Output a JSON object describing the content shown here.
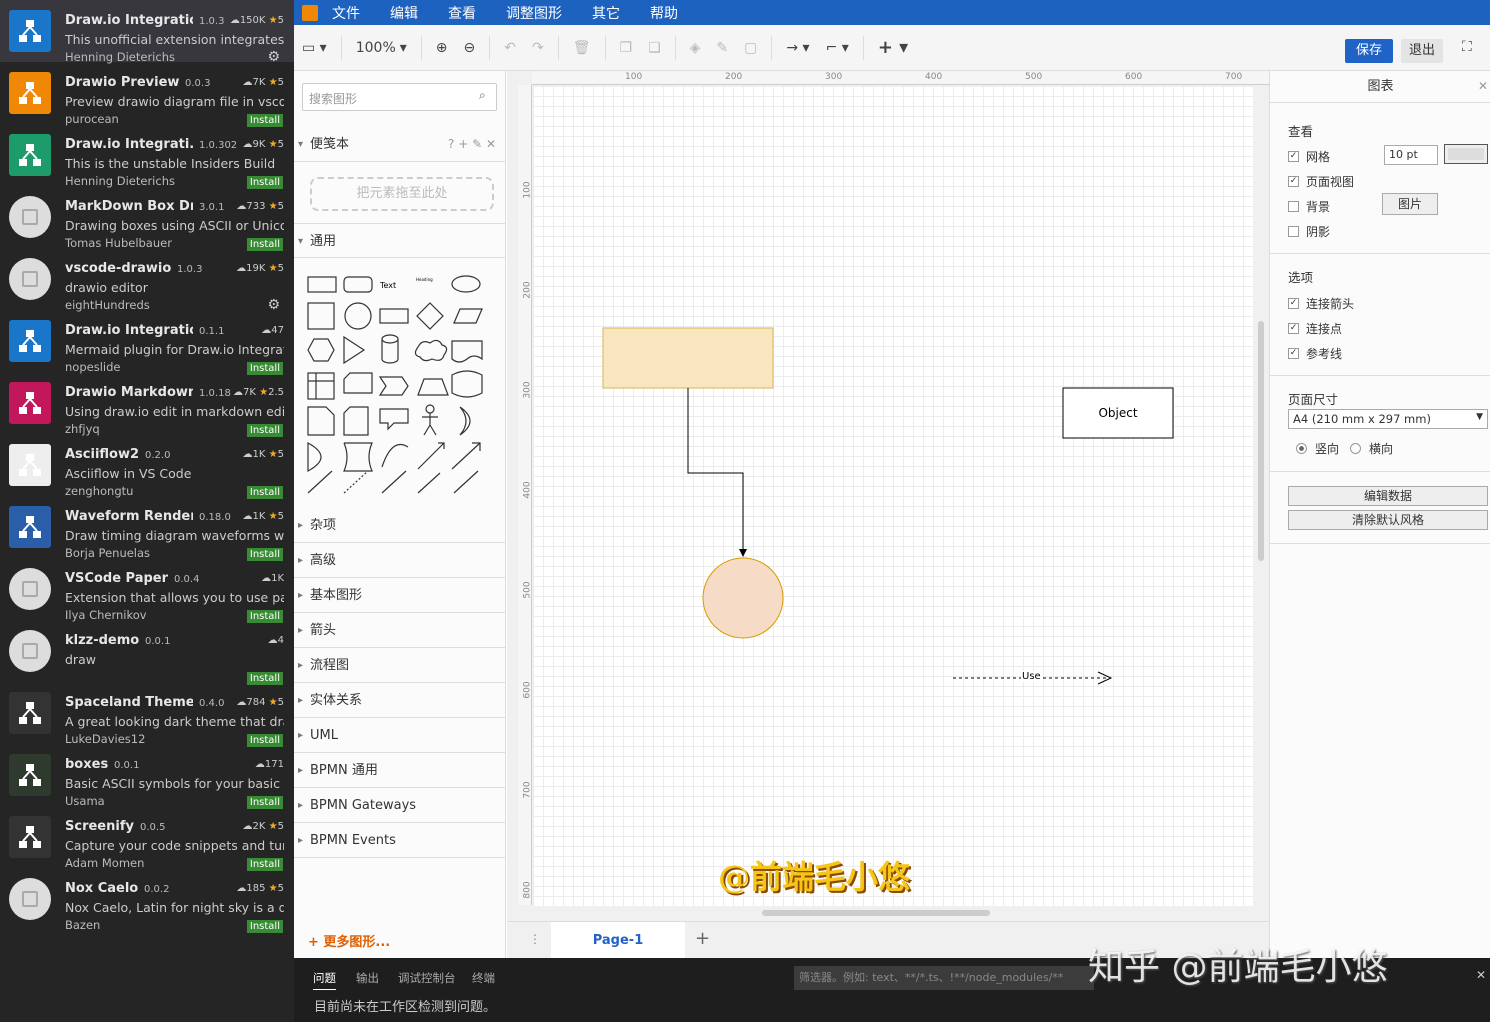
{
  "extensions": [
    {
      "name": "Draw.io Integration",
      "version": "1.0.3",
      "downloads": "150K",
      "rating": "5",
      "desc": "This unofficial extension integrates ...",
      "author": "Henning Dieterichs",
      "action": "gear",
      "color": "#1976c9"
    },
    {
      "name": "Drawio Preview",
      "version": "0.0.3",
      "downloads": "7K",
      "rating": "5",
      "desc": "Preview drawio diagram file in vsco...",
      "author": "purocean",
      "action": "Install",
      "color": "#f08705"
    },
    {
      "name": "Draw.io Integrati...",
      "version": "1.0.302",
      "downloads": "9K",
      "rating": "5",
      "desc": "This is the unstable Insiders Build",
      "author": "Henning Dieterichs",
      "action": "Install",
      "color": "#1e9b6a"
    },
    {
      "name": "MarkDown Box Dr...",
      "version": "3.0.1",
      "downloads": "733",
      "rating": "5",
      "desc": "Drawing boxes using ASCII or Unico...",
      "author": "Tomas Hubelbauer",
      "action": "Install",
      "color": "gray"
    },
    {
      "name": "vscode-drawio",
      "version": "1.0.3",
      "downloads": "19K",
      "rating": "5",
      "desc": "drawio editor",
      "author": "eightHundreds",
      "action": "gear",
      "color": "gray"
    },
    {
      "name": "Draw.io Integration: M...",
      "version": "0.1.1",
      "downloads": "47",
      "rating": "",
      "desc": "Mermaid plugin for Draw.io Integrat...",
      "author": "nopeslide",
      "action": "Install",
      "color": "#1976c9"
    },
    {
      "name": "Drawio Markdown",
      "version": "1.0.18",
      "downloads": "7K",
      "rating": "2.5",
      "desc": "Using draw.io edit in markdown edit...",
      "author": "zhfjyq",
      "action": "Install",
      "color": "#c2185b"
    },
    {
      "name": "Asciiflow2",
      "version": "0.2.0",
      "downloads": "1K",
      "rating": "5",
      "desc": "Asciiflow in VS Code",
      "author": "zenghongtu",
      "action": "Install",
      "color": "#eee"
    },
    {
      "name": "Waveform Render",
      "version": "0.18.0",
      "downloads": "1K",
      "rating": "5",
      "desc": "Draw timing diagram waveforms wit...",
      "author": "Borja Penuelas",
      "action": "Install",
      "color": "#2b5ea8"
    },
    {
      "name": "VSCode Paper",
      "version": "0.0.4",
      "downloads": "1K",
      "rating": "",
      "desc": "Extension that allows you to use pa...",
      "author": "Ilya Chernikov",
      "action": "Install",
      "color": "gray"
    },
    {
      "name": "klzz-demo",
      "version": "0.0.1",
      "downloads": "4",
      "rating": "",
      "desc": "draw",
      "author": "",
      "action": "Install",
      "color": "gray"
    },
    {
      "name": "Spaceland Theme",
      "version": "0.4.0",
      "downloads": "784",
      "rating": "5",
      "desc": "A great looking dark theme that dra...",
      "author": "LukeDavies12",
      "action": "Install",
      "color": "#333"
    },
    {
      "name": "boxes",
      "version": "0.0.1",
      "downloads": "171",
      "rating": "",
      "desc": "Basic ASCII symbols for your basic d...",
      "author": "Usama",
      "action": "Install",
      "color": "#2d3a2d"
    },
    {
      "name": "Screenify",
      "version": "0.0.5",
      "downloads": "2K",
      "rating": "5",
      "desc": "Capture your code snippets and tur...",
      "author": "Adam Momen",
      "action": "Install",
      "color": "#333"
    },
    {
      "name": "Nox Caelo",
      "version": "0.0.2",
      "downloads": "185",
      "rating": "5",
      "desc": "Nox Caelo, Latin for night sky is a da...",
      "author": "Bazen",
      "action": "Install",
      "color": "gray"
    }
  ],
  "menu": [
    "文件",
    "编辑",
    "查看",
    "调整图形",
    "其它",
    "帮助"
  ],
  "toolbar": {
    "zoom": "100%",
    "save": "保存",
    "quit": "退出"
  },
  "shapes": {
    "search_placeholder": "搜索图形",
    "scratchpad": "便笺本",
    "scratch_tools": "? + ✎ ✕",
    "drop_hint": "把元素拖至此处",
    "general": "通用",
    "sections": [
      "杂项",
      "高级",
      "基本图形",
      "箭头",
      "流程图",
      "实体关系",
      "UML",
      "BPMN 通用",
      "BPMN Gateways",
      "BPMN Events"
    ],
    "more": "+ 更多图形..."
  },
  "ruler": {
    "h": [
      "100",
      "200",
      "300",
      "400",
      "500",
      "600",
      "700"
    ],
    "v": [
      "100",
      "200",
      "300",
      "400",
      "500",
      "600",
      "700",
      "800"
    ]
  },
  "canvas": {
    "object_label": "Object",
    "edge_label": "Use",
    "page_tab": "Page-1"
  },
  "format": {
    "title": "图表",
    "view": "查看",
    "grid": "网格",
    "grid_size": "10 pt",
    "page_view": "页面视图",
    "background": "背景",
    "image_btn": "图片",
    "shadow": "阴影",
    "options": "选项",
    "connect_arrows": "连接箭头",
    "connect_points": "连接点",
    "guides": "参考线",
    "page_size": "页面尺寸",
    "paper": "A4 (210 mm x 297 mm)",
    "portrait": "竖向",
    "landscape": "横向",
    "edit_data": "编辑数据",
    "clear_style": "清除默认风格"
  },
  "bottom": {
    "tabs": [
      "问题",
      "输出",
      "调试控制台",
      "终端"
    ],
    "filter": "筛选器。例如: text、**/*.ts、!**/node_modules/**",
    "message": "目前尚未在工作区检测到问题。"
  },
  "watermark": "@前端毛小悠",
  "watermark2": "知乎 @前端毛小悠"
}
